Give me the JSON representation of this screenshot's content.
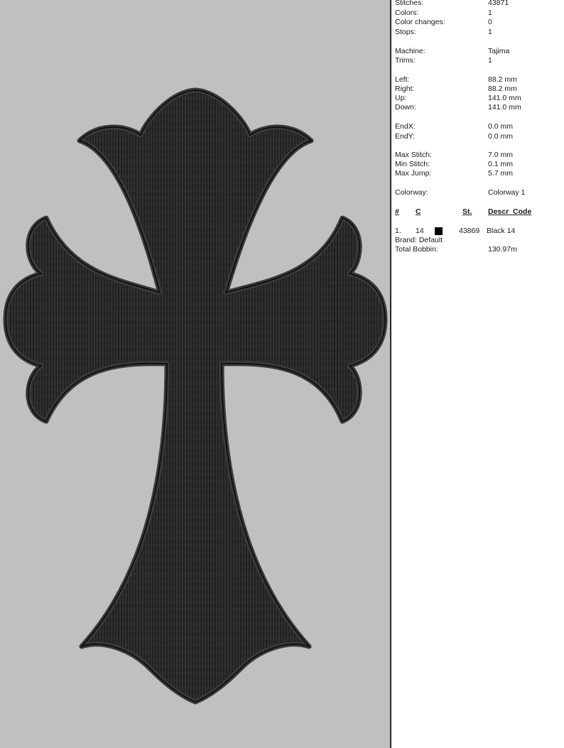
{
  "design_info": {
    "stitches": {
      "label": "Stitches:",
      "value": "43871"
    },
    "colors": {
      "label": "Colors:",
      "value": "1"
    },
    "color_changes": {
      "label": "Color changes:",
      "value": "0"
    },
    "stops": {
      "label": "Stops:",
      "value": "1"
    },
    "machine": {
      "label": "Machine:",
      "value": "Tajima"
    },
    "trims": {
      "label": "Trims:",
      "value": "1"
    },
    "left": {
      "label": "Left:",
      "value": "88.2 mm"
    },
    "right": {
      "label": "Right:",
      "value": "88.2 mm"
    },
    "up": {
      "label": "Up:",
      "value": "141.0 mm"
    },
    "down": {
      "label": "Down:",
      "value": "141.0 mm"
    },
    "end_x": {
      "label": "EndX:",
      "value": "0.0 mm"
    },
    "end_y": {
      "label": "EndY:",
      "value": "0.0 mm"
    },
    "max_stitch": {
      "label": "Max Stitch:",
      "value": "7.0 mm"
    },
    "min_stitch": {
      "label": "Min Stitch:",
      "value": "0.1 mm"
    },
    "max_jump": {
      "label": "Max Jump:",
      "value": "5.7 mm"
    },
    "colorway": {
      "label": "Colorway:",
      "value": "Colorway 1"
    }
  },
  "color_table": {
    "headers": {
      "num": "#",
      "color": "C",
      "stitches": "St.",
      "descr": "Descr_Code"
    },
    "rows": [
      {
        "num": "1.",
        "color_code": "14",
        "swatch_color": "#000000",
        "stitches": "43869",
        "descr": "Black 14"
      }
    ],
    "brand": "Brand: Default",
    "total_bobbin_label": "Total Bobbin:",
    "total_bobbin_value": "130.97m"
  },
  "preview": {
    "background_color": "#c0c0c0",
    "thread_color": "#1e1e1e",
    "design_icon": "gothic-cross-icon"
  }
}
